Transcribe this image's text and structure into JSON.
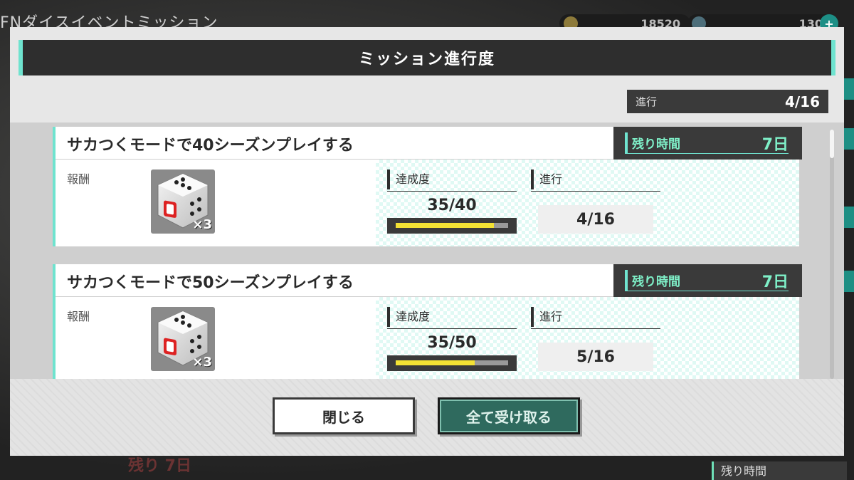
{
  "background": {
    "title": "FNダイスイベントミッション",
    "coins": [
      "18520",
      "130"
    ],
    "bottom_left": "残り 7日",
    "bottom_right": "残り時間"
  },
  "modal": {
    "title": "ミッション進行度",
    "total_progress": {
      "label": "進行",
      "value": "4/16"
    },
    "missions": [
      {
        "title": "サカつくモードで40シーズンプレイする",
        "remaining_label": "残り時間",
        "remaining_value": "7日",
        "reward_label": "報酬",
        "reward_item_icon": "dice-icon",
        "reward_count": "×3",
        "achievement_label": "達成度",
        "achievement_value": "35/40",
        "achievement_ratio": 0.875,
        "progress_label": "進行",
        "progress_value": "4/16"
      },
      {
        "title": "サカつくモードで50シーズンプレイする",
        "remaining_label": "残り時間",
        "remaining_value": "7日",
        "reward_label": "報酬",
        "reward_item_icon": "dice-icon",
        "reward_count": "×3",
        "achievement_label": "達成度",
        "achievement_value": "35/50",
        "achievement_ratio": 0.7,
        "progress_label": "進行",
        "progress_value": "5/16"
      }
    ],
    "buttons": {
      "close": "閉じる",
      "receive_all": "全て受け取る"
    }
  },
  "colors": {
    "accent": "#6fe3cf",
    "bar_fill": "#f3e234",
    "header_bg": "#2e2e2e"
  }
}
